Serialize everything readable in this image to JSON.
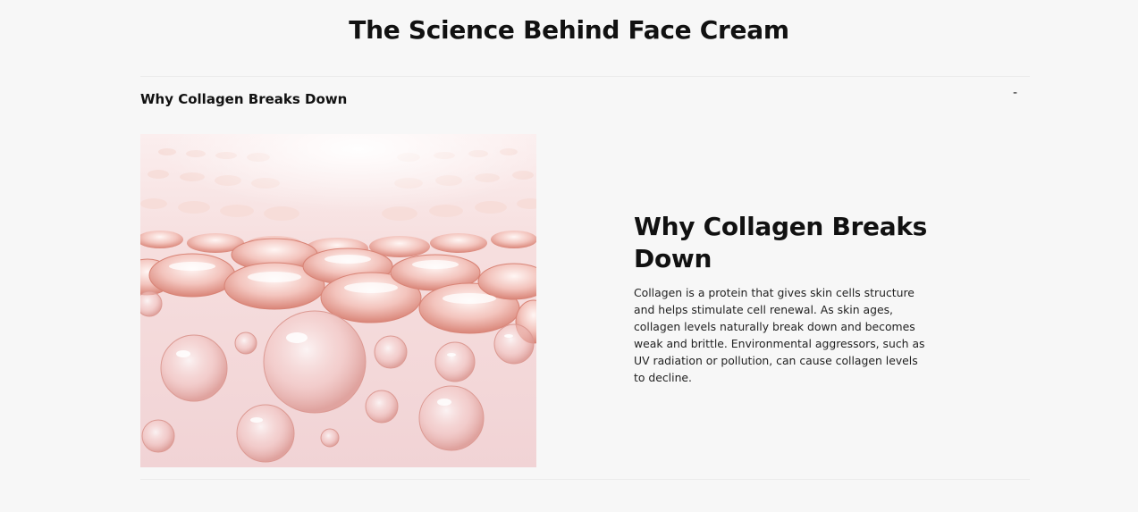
{
  "page": {
    "title": "The Science Behind Face Cream"
  },
  "accordion": {
    "item_title": "Why Collagen Breaks Down",
    "toggle_symbol": "-",
    "expanded": true
  },
  "content": {
    "heading": "Why Collagen Breaks Down",
    "body": "Collagen is a protein that gives skin cells structure and helps stimulate cell renewal. As skin ages, collagen levels naturally break down and becomes weak and brittle. Environmental aggressors, such as UV radiation or pollution, can cause collagen levels to decline."
  },
  "colors": {
    "background": "#f7f7f7",
    "text": "#111111",
    "divider": "#ebebeb",
    "image_pink": "#e9a9a1"
  }
}
